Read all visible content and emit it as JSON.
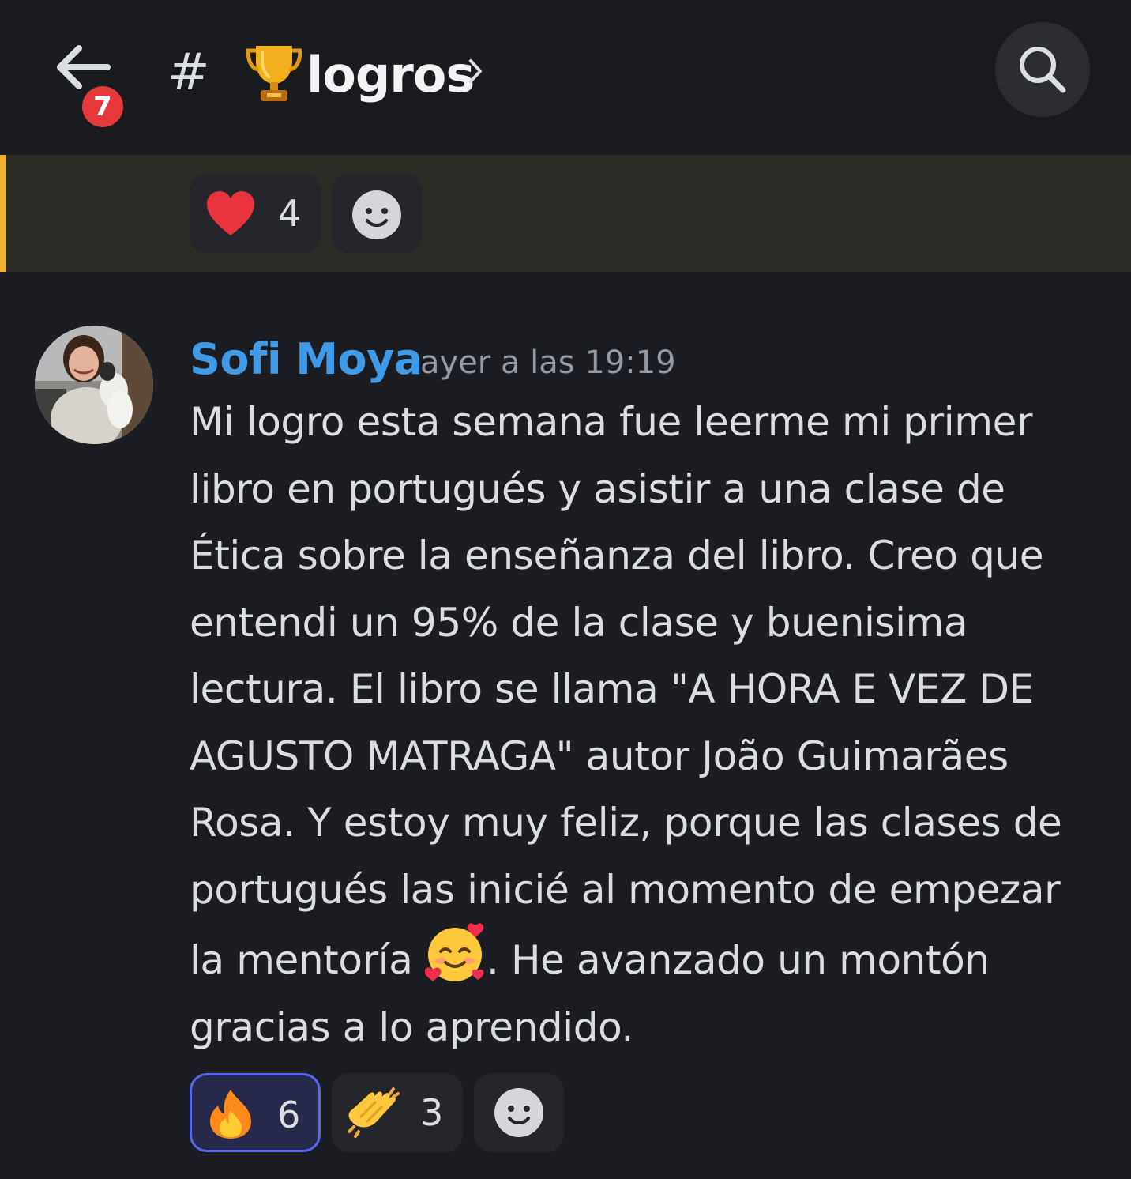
{
  "header": {
    "back_badge_count": "7",
    "hash_symbol": "#",
    "channel_name": "logros"
  },
  "top_reactions": [
    {
      "emoji": "heart",
      "count": "4"
    },
    {
      "emoji": "add-reaction",
      "count": ""
    }
  ],
  "message": {
    "author": "Sofi Moya",
    "timestamp": "ayer a las 19:19",
    "text_part1": "Mi logro esta semana fue leerme mi primer libro en portugués y asistir a una clase de Ética sobre la enseñanza del libro. Creo que entendi un 95% de la clase y buenisima lectura. El libro se llama \"A HORA E VEZ DE AGUSTO MATRAGA\" autor João Guimarães Rosa. Y estoy muy feliz, porque las clases de portugués las inicié al momento de empezar la mentoría ",
    "text_part2": ". He avanzado un montón gracias a lo aprendido.",
    "inline_emoji": "smiling-face-with-hearts"
  },
  "message_reactions": [
    {
      "emoji": "fire",
      "count": "6",
      "active": true
    },
    {
      "emoji": "clapping-hands",
      "count": "3",
      "active": false
    },
    {
      "emoji": "add-reaction",
      "count": "",
      "active": false
    }
  ],
  "colors": {
    "background": "#1c1d22",
    "author": "#3f9ae8",
    "highlight_bar": "#f0b232",
    "badge": "#e5383b",
    "active_reaction_border": "#5865f2"
  }
}
